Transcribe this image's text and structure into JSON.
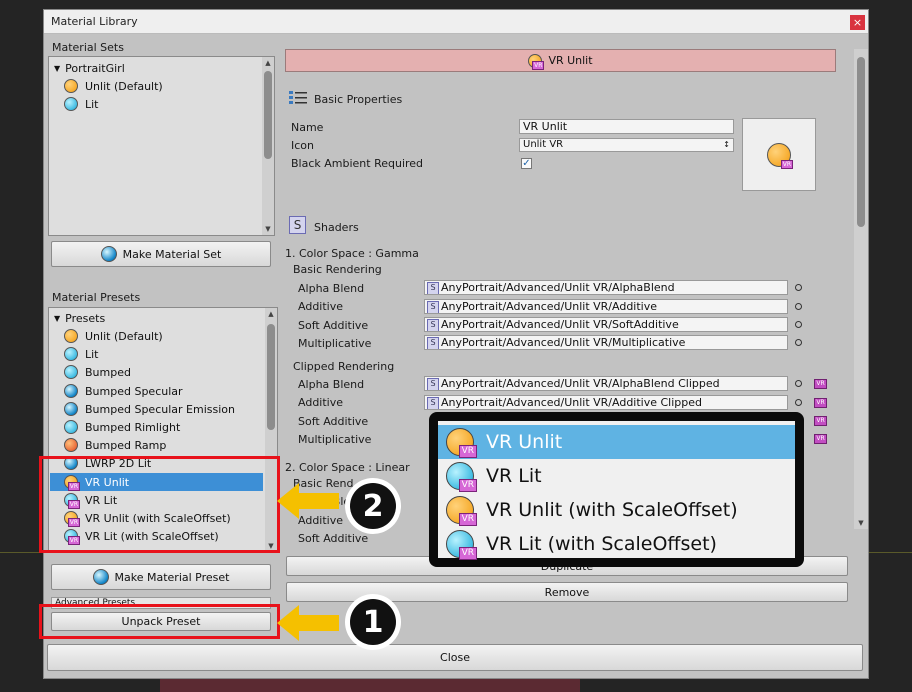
{
  "window": {
    "title": "Material Library",
    "close_glyph": "×"
  },
  "material_sets": {
    "label": "Material Sets",
    "group": "PortraitGirl",
    "items": [
      {
        "label": "Unlit (Default)",
        "icon": "orange-sphere-icon"
      },
      {
        "label": "Lit",
        "icon": "cyan-sphere-icon"
      }
    ],
    "make_button": "Make Material Set"
  },
  "material_presets": {
    "label": "Material Presets",
    "group": "Presets",
    "items": [
      {
        "label": "Unlit (Default)",
        "icon": "orange"
      },
      {
        "label": "Lit",
        "icon": "cyan"
      },
      {
        "label": "Bumped",
        "icon": "cyan"
      },
      {
        "label": "Bumped Specular",
        "icon": "blueball"
      },
      {
        "label": "Bumped Specular Emission",
        "icon": "blueball"
      },
      {
        "label": "Bumped Rimlight",
        "icon": "cyan"
      },
      {
        "label": "Bumped Ramp",
        "icon": "red"
      },
      {
        "label": "LWRP 2D Lit",
        "icon": "blueball"
      },
      {
        "label": "VR Unlit",
        "icon": "orange-vr",
        "selected": true
      },
      {
        "label": "VR Lit",
        "icon": "cyan-vr"
      },
      {
        "label": "VR Unlit (with ScaleOffset)",
        "icon": "orange-vr"
      },
      {
        "label": "VR Lit (with ScaleOffset)",
        "icon": "cyan-vr"
      }
    ],
    "make_button": "Make Material Preset",
    "advanced_presets": "Advanced Presets",
    "unpack_button": "Unpack Preset"
  },
  "detail": {
    "header_title": "VR Unlit",
    "basic_properties": "Basic Properties",
    "name_label": "Name",
    "name_value": "VR Unlit",
    "icon_label": "Icon",
    "icon_value": "Unlit VR",
    "black_ambient_label": "Black Ambient Required",
    "black_ambient_checked": true,
    "shaders_label": "Shaders",
    "color_space_gamma": "1. Color Space : Gamma",
    "basic_rendering": "Basic Rendering",
    "clipped_rendering": "Clipped Rendering",
    "color_space_linear": "2. Color Space : Linear",
    "gamma_basic": [
      {
        "label": "Alpha Blend",
        "path": "AnyPortrait/Advanced/Unlit VR/AlphaBlend"
      },
      {
        "label": "Additive",
        "path": "AnyPortrait/Advanced/Unlit VR/Additive"
      },
      {
        "label": "Soft Additive",
        "path": "AnyPortrait/Advanced/Unlit VR/SoftAdditive"
      },
      {
        "label": "Multiplicative",
        "path": "AnyPortrait/Advanced/Unlit VR/Multiplicative"
      }
    ],
    "gamma_clipped": [
      {
        "label": "Alpha Blend",
        "path": "AnyPortrait/Advanced/Unlit VR/AlphaBlend Clipped"
      },
      {
        "label": "Additive",
        "path": "AnyPortrait/Advanced/Unlit VR/Additive Clipped"
      },
      {
        "label": "Soft Additive",
        "path": ""
      },
      {
        "label": "Multiplicative",
        "path": ""
      }
    ],
    "linear_partial": [
      "Basic Rend",
      "Alpha Ble",
      "Additive",
      "Soft Additive"
    ],
    "duplicate_button": "Duplicate",
    "remove_button": "Remove"
  },
  "close_button": "Close",
  "popup": {
    "items": [
      {
        "label": "VR Unlit",
        "icon": "orange",
        "selected": true
      },
      {
        "label": "VR Lit",
        "icon": "cyan"
      },
      {
        "label": "VR Unlit (with ScaleOffset)",
        "icon": "orange"
      },
      {
        "label": "VR Lit (with ScaleOffset)",
        "icon": "cyan"
      }
    ]
  },
  "annotations": {
    "step1": "1",
    "step2": "2",
    "highlight_color": "#e8121b",
    "arrow_color": "#f5c000"
  }
}
